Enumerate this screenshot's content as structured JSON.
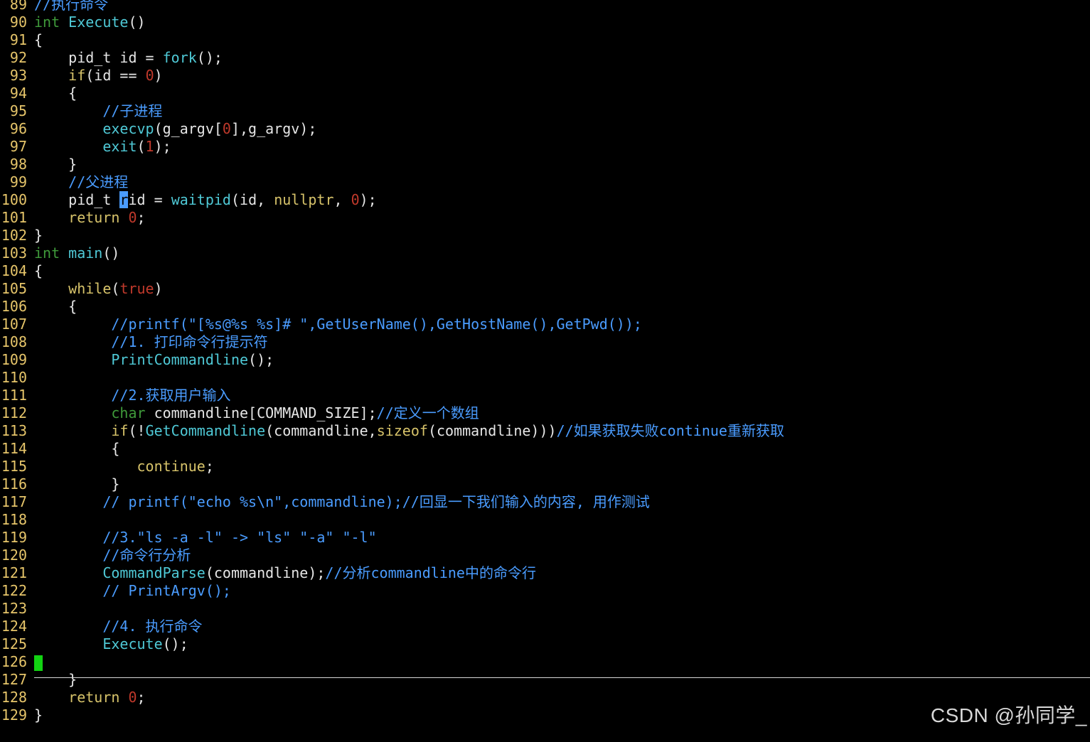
{
  "watermark": "CSDN @孙同学_",
  "colors": {
    "background": "#000000",
    "line_number": "#e6c56a",
    "type_keyword": "#3f9a3a",
    "keyword": "#d7c36a",
    "function": "#4fc9d6",
    "number": "#c0392b",
    "comment": "#4a9cff",
    "text": "#e6e6e6",
    "cursor": "#12d312"
  },
  "lines": [
    {
      "n": "89",
      "segs": [
        [
          "cmt",
          "//执行命令"
        ]
      ]
    },
    {
      "n": "90",
      "segs": [
        [
          "kw-type",
          "int"
        ],
        [
          "txt",
          " "
        ],
        [
          "fn",
          "Execute"
        ],
        [
          "txt",
          "()"
        ]
      ]
    },
    {
      "n": "91",
      "segs": [
        [
          "txt",
          "{"
        ]
      ]
    },
    {
      "n": "92",
      "segs": [
        [
          "txt",
          "    pid_t id = "
        ],
        [
          "fn",
          "fork"
        ],
        [
          "txt",
          "();"
        ]
      ]
    },
    {
      "n": "93",
      "segs": [
        [
          "txt",
          "    "
        ],
        [
          "kw",
          "if"
        ],
        [
          "txt",
          "(id == "
        ],
        [
          "num",
          "0"
        ],
        [
          "txt",
          ")"
        ]
      ]
    },
    {
      "n": "94",
      "segs": [
        [
          "txt",
          "    {"
        ]
      ]
    },
    {
      "n": "95",
      "segs": [
        [
          "txt",
          "        "
        ],
        [
          "cmt",
          "//子进程"
        ]
      ]
    },
    {
      "n": "96",
      "segs": [
        [
          "txt",
          "        "
        ],
        [
          "fn",
          "execvp"
        ],
        [
          "txt",
          "(g_argv["
        ],
        [
          "num",
          "0"
        ],
        [
          "txt",
          "],g_argv);"
        ]
      ]
    },
    {
      "n": "97",
      "segs": [
        [
          "txt",
          "        "
        ],
        [
          "fn",
          "exit"
        ],
        [
          "txt",
          "("
        ],
        [
          "num",
          "1"
        ],
        [
          "txt",
          ");"
        ]
      ]
    },
    {
      "n": "98",
      "segs": [
        [
          "txt",
          "    }"
        ]
      ]
    },
    {
      "n": "99",
      "segs": [
        [
          "txt",
          "    "
        ],
        [
          "cmt",
          "//父进程"
        ]
      ]
    },
    {
      "n": "100",
      "segs": [
        [
          "txt",
          "    pid_t "
        ],
        [
          "cursor",
          "r"
        ],
        [
          "txt",
          "id = "
        ],
        [
          "fn",
          "waitpid"
        ],
        [
          "txt",
          "(id, "
        ],
        [
          "kw",
          "nullptr"
        ],
        [
          "txt",
          ", "
        ],
        [
          "num",
          "0"
        ],
        [
          "txt",
          ");"
        ]
      ]
    },
    {
      "n": "101",
      "segs": [
        [
          "txt",
          "    "
        ],
        [
          "kw",
          "return"
        ],
        [
          "txt",
          " "
        ],
        [
          "num",
          "0"
        ],
        [
          "txt",
          ";"
        ]
      ]
    },
    {
      "n": "102",
      "segs": [
        [
          "txt",
          "}"
        ]
      ]
    },
    {
      "n": "103",
      "segs": [
        [
          "kw-type",
          "int"
        ],
        [
          "txt",
          " "
        ],
        [
          "fn",
          "main"
        ],
        [
          "txt",
          "()"
        ]
      ]
    },
    {
      "n": "104",
      "segs": [
        [
          "txt",
          "{"
        ]
      ]
    },
    {
      "n": "105",
      "segs": [
        [
          "txt",
          "    "
        ],
        [
          "kw",
          "while"
        ],
        [
          "txt",
          "("
        ],
        [
          "num",
          "true"
        ],
        [
          "txt",
          ")"
        ]
      ]
    },
    {
      "n": "106",
      "segs": [
        [
          "txt",
          "    {"
        ]
      ]
    },
    {
      "n": "107",
      "segs": [
        [
          "txt",
          "         "
        ],
        [
          "cmt",
          "//printf(\"[%s@%s %s]# \",GetUserName(),GetHostName(),GetPwd());"
        ]
      ]
    },
    {
      "n": "108",
      "segs": [
        [
          "txt",
          "         "
        ],
        [
          "cmt",
          "//1. 打印命令行提示符"
        ]
      ]
    },
    {
      "n": "109",
      "segs": [
        [
          "txt",
          "         "
        ],
        [
          "fn",
          "PrintCommandline"
        ],
        [
          "txt",
          "();"
        ]
      ]
    },
    {
      "n": "110",
      "segs": []
    },
    {
      "n": "111",
      "segs": [
        [
          "txt",
          "         "
        ],
        [
          "cmt",
          "//2.获取用户输入"
        ]
      ]
    },
    {
      "n": "112",
      "segs": [
        [
          "txt",
          "         "
        ],
        [
          "kw-type",
          "char"
        ],
        [
          "txt",
          " commandline[COMMAND_SIZE];"
        ],
        [
          "cmt",
          "//定义一个数组"
        ]
      ]
    },
    {
      "n": "113",
      "segs": [
        [
          "txt",
          "         "
        ],
        [
          "kw",
          "if"
        ],
        [
          "txt",
          "(!"
        ],
        [
          "fn",
          "GetCommandline"
        ],
        [
          "txt",
          "(commandline,"
        ],
        [
          "kw",
          "sizeof"
        ],
        [
          "txt",
          "(commandline)))"
        ],
        [
          "cmt",
          "//如果获取失败continue重新获取"
        ]
      ]
    },
    {
      "n": "114",
      "segs": [
        [
          "txt",
          "         {"
        ]
      ]
    },
    {
      "n": "115",
      "segs": [
        [
          "txt",
          "            "
        ],
        [
          "kw",
          "continue"
        ],
        [
          "txt",
          ";"
        ]
      ]
    },
    {
      "n": "116",
      "segs": [
        [
          "txt",
          "         }"
        ]
      ]
    },
    {
      "n": "117",
      "segs": [
        [
          "txt",
          "        "
        ],
        [
          "cmt",
          "// printf(\"echo %s\\n\",commandline);//回显一下我们输入的内容, 用作测试"
        ]
      ]
    },
    {
      "n": "118",
      "segs": []
    },
    {
      "n": "119",
      "segs": [
        [
          "txt",
          "        "
        ],
        [
          "cmt",
          "//3.\"ls -a -l\" -> \"ls\" \"-a\" \"-l\""
        ]
      ]
    },
    {
      "n": "120",
      "segs": [
        [
          "txt",
          "        "
        ],
        [
          "cmt",
          "//命令行分析"
        ]
      ]
    },
    {
      "n": "121",
      "segs": [
        [
          "txt",
          "        "
        ],
        [
          "fn",
          "CommandParse"
        ],
        [
          "txt",
          "(commandline);"
        ],
        [
          "cmt",
          "//分析commandline中的命令行"
        ]
      ]
    },
    {
      "n": "122",
      "segs": [
        [
          "txt",
          "        "
        ],
        [
          "cmt",
          "// PrintArgv();"
        ]
      ]
    },
    {
      "n": "123",
      "segs": []
    },
    {
      "n": "124",
      "segs": [
        [
          "txt",
          "        "
        ],
        [
          "cmt",
          "//4. 执行命令"
        ]
      ]
    },
    {
      "n": "125",
      "segs": [
        [
          "txt",
          "        "
        ],
        [
          "fn",
          "Execute"
        ],
        [
          "txt",
          "();"
        ]
      ]
    },
    {
      "n": "126",
      "segs": [],
      "cursor_block": true
    },
    {
      "n": "127",
      "segs": [
        [
          "txt",
          "    }"
        ]
      ]
    },
    {
      "n": "128",
      "segs": [
        [
          "txt",
          "    "
        ],
        [
          "kw",
          "return"
        ],
        [
          "txt",
          " "
        ],
        [
          "num",
          "0"
        ],
        [
          "txt",
          ";"
        ]
      ]
    },
    {
      "n": "129",
      "segs": [
        [
          "txt",
          "}"
        ]
      ]
    }
  ]
}
